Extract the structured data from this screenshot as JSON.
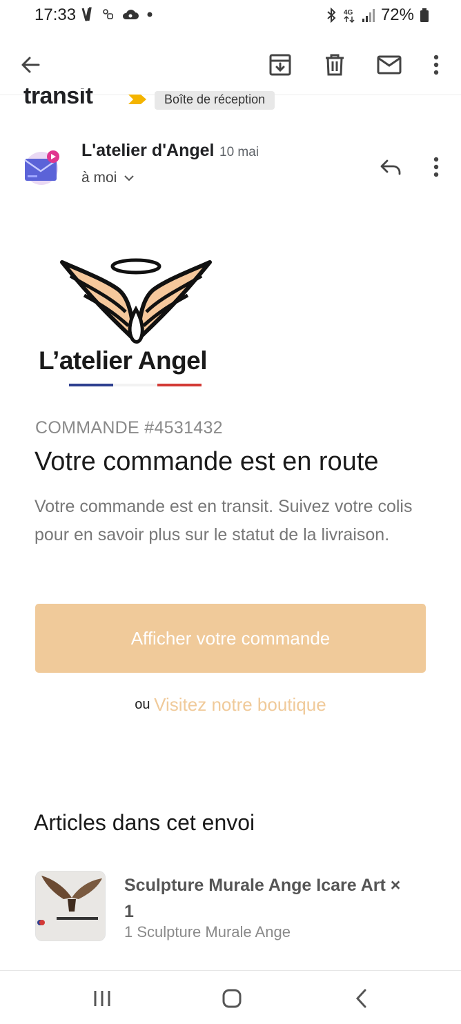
{
  "status_bar": {
    "time": "17:33",
    "battery": "72%",
    "network": "4G"
  },
  "action_bar": {
    "icons": [
      "back-arrow-icon",
      "archive-icon",
      "delete-icon",
      "mail-icon",
      "more-vert-icon"
    ]
  },
  "snippet": {
    "word": "transit",
    "label_chip": "Boîte de réception"
  },
  "sender": {
    "name": "L'atelier d'Angel",
    "date": "10 mai",
    "recipient": "à moi"
  },
  "logo": {
    "text": "L’atelier Angel"
  },
  "email": {
    "order_number": "COMMANDE #4531432",
    "headline": "Votre commande est en route",
    "body": "Votre commande est en transit. Suivez votre colis pour en savoir plus sur le statut de la livraison.",
    "cta_label": "Afficher votre commande",
    "or_label": "ou",
    "shop_link": "Visitez notre boutique",
    "accent_color": "#f0ca9a"
  },
  "articles": {
    "heading": "Articles dans cet envoi",
    "items": [
      {
        "title": "Sculpture Murale Ange Icare Art × 1",
        "subtitle": "1 Sculpture Murale Ange"
      }
    ]
  }
}
